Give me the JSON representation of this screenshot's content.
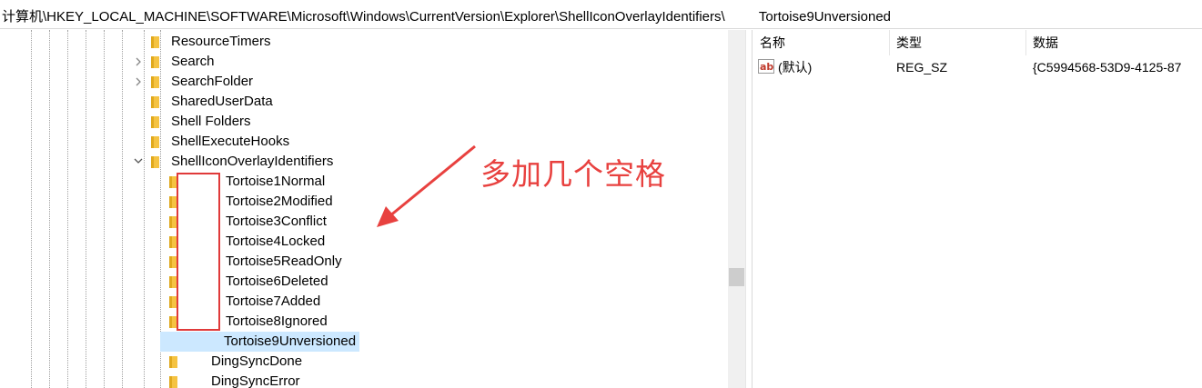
{
  "address_bar": {
    "path": "计算机\\HKEY_LOCAL_MACHINE\\SOFTWARE\\Microsoft\\Windows\\CurrentVersion\\Explorer\\ShellIconOverlayIdentifiers\\         Tortoise9Unversioned"
  },
  "tree": {
    "nodes": [
      {
        "label": "ResourceTimers",
        "expander": ""
      },
      {
        "label": "Search",
        "expander": ">"
      },
      {
        "label": "SearchFolder",
        "expander": ">"
      },
      {
        "label": "SharedUserData",
        "expander": ""
      },
      {
        "label": "Shell Folders",
        "expander": ""
      },
      {
        "label": "ShellExecuteHooks",
        "expander": ""
      },
      {
        "label": "ShellIconOverlayIdentifiers",
        "expander": "v"
      },
      {
        "label": "Tortoise1Normal",
        "expander": ""
      },
      {
        "label": "Tortoise2Modified",
        "expander": ""
      },
      {
        "label": "Tortoise3Conflict",
        "expander": ""
      },
      {
        "label": "Tortoise4Locked",
        "expander": ""
      },
      {
        "label": "Tortoise5ReadOnly",
        "expander": ""
      },
      {
        "label": "Tortoise6Deleted",
        "expander": ""
      },
      {
        "label": "Tortoise7Added",
        "expander": ""
      },
      {
        "label": "Tortoise8Ignored",
        "expander": ""
      },
      {
        "label": "Tortoise9Unversioned",
        "expander": "",
        "selected": true
      },
      {
        "label": "DingSyncDone",
        "expander": ""
      },
      {
        "label": "DingSyncError",
        "expander": ""
      }
    ]
  },
  "list": {
    "headers": {
      "name": "名称",
      "type": "类型",
      "data": "数据"
    },
    "rows": [
      {
        "name": "(默认)",
        "type": "REG_SZ",
        "data": "{C5994568-53D9-4125-87"
      }
    ]
  },
  "annotation": {
    "text": "多加几个空格",
    "color": "#e8413f"
  },
  "colors": {
    "selection": "#cce8ff",
    "folder": "#f5c342"
  }
}
